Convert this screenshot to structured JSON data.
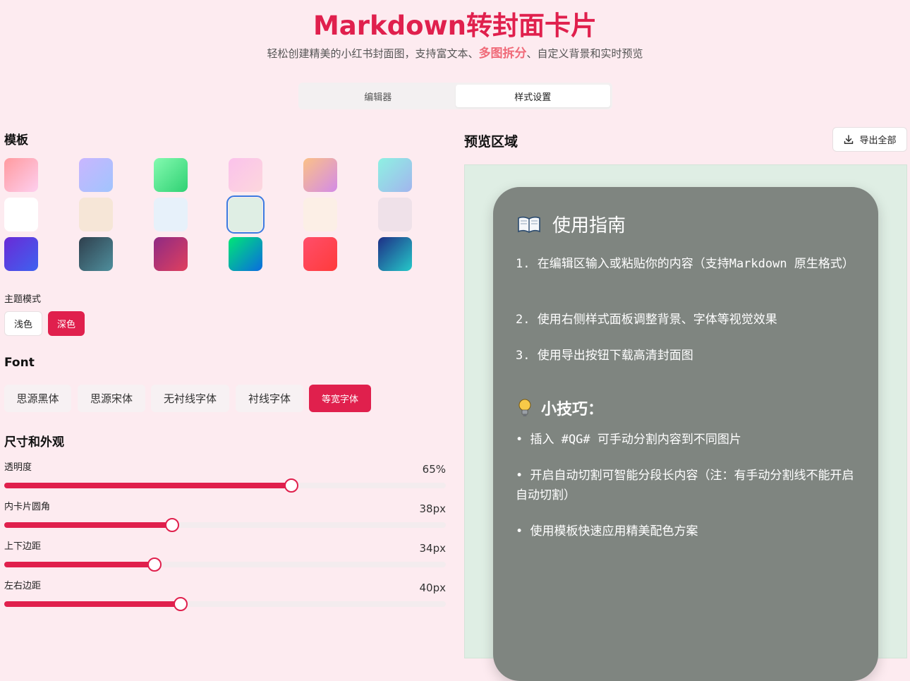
{
  "header": {
    "title": "Markdown转封面卡片",
    "subtitle_before": "轻松创建精美的小红书封面图，支持富文本、",
    "subtitle_highlight": "多图拆分",
    "subtitle_after": "、自定义背景和实时预览"
  },
  "tabs": [
    {
      "label": "编辑器",
      "active": false
    },
    {
      "label": "样式设置",
      "active": true
    }
  ],
  "templates": {
    "title": "模板",
    "selected_index": 9,
    "swatches": [
      "linear-gradient(135deg,#ff9a9e,#fecfef)",
      "linear-gradient(135deg,#c9b6ff,#a1c4fd)",
      "linear-gradient(135deg,#84fab0,#2fd173)",
      "linear-gradient(135deg,#fbc2eb,#fcd7dd)",
      "linear-gradient(135deg,#fbc187,#d38be7)",
      "linear-gradient(135deg,#8ef1e2,#a2b5ee)",
      "#ffffff",
      "#f6e6d7",
      "#e7f1fa",
      "#dfeee4",
      "#fcefe6",
      "#efe1e9",
      "linear-gradient(135deg,#6a2ad6,#3e62f0)",
      "linear-gradient(135deg,#2f3f4d,#4f8f9d)",
      "linear-gradient(135deg,#8e2a84,#e0405e)",
      "linear-gradient(135deg,#00e676,#0a6be0)",
      "linear-gradient(135deg,#ff4e6a,#ff3b3b)",
      "linear-gradient(135deg,#1e2e86,#25c9c9)"
    ]
  },
  "theme_mode": {
    "label": "主题模式",
    "light": "浅色",
    "dark": "深色",
    "selected": "dark"
  },
  "font": {
    "title": "Font",
    "options": [
      "思源黑体",
      "思源宋体",
      "无衬线字体",
      "衬线字体",
      "等宽字体"
    ],
    "selected_index": 4
  },
  "size": {
    "title": "尺寸和外观",
    "sliders": [
      {
        "label": "透明度",
        "value": 65,
        "display": "65%",
        "min": 0,
        "max": 100
      },
      {
        "label": "内卡片圆角",
        "value": 38,
        "display": "38px",
        "min": 0,
        "max": 100
      },
      {
        "label": "上下边距",
        "value": 34,
        "display": "34px",
        "min": 0,
        "max": 100
      },
      {
        "label": "左右边距",
        "value": 40,
        "display": "40px",
        "min": 0,
        "max": 100
      }
    ]
  },
  "preview": {
    "title": "预览区域",
    "export_label": "导出全部",
    "background": "#dfeee4",
    "card_color": "#7f8580",
    "heading1": "使用指南",
    "steps": [
      "1. 在编辑区输入或粘贴你的内容（支持Markdown 原生格式）",
      "2. 使用右侧样式面板调整背景、字体等视觉效果",
      "3. 使用导出按钮下载高清封面图"
    ],
    "heading2": "小技巧：",
    "tips": [
      "• 插入 #QG# 可手动分割内容到不同图片",
      "• 开启自动切割可智能分段长内容（注：有手动分割线不能开启自动切割）",
      "• 使用模板快速应用精美配色方案"
    ]
  },
  "colors": {
    "accent": "#e0204d",
    "page_bg": "#fdebf0",
    "selected_outline": "#3b7be0"
  }
}
